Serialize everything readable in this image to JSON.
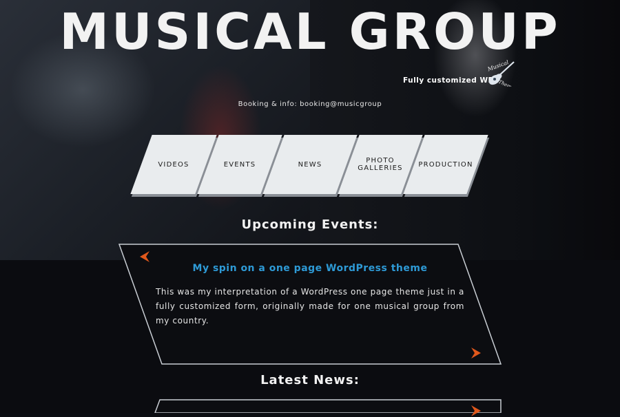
{
  "header": {
    "brand": "MUSICAL GROUP",
    "tagline": "Fully customized WP",
    "logo_text": "Musical Theme",
    "booking": "Booking & info: booking@musicgroup"
  },
  "nav": {
    "items": [
      {
        "label": "VIDEOS"
      },
      {
        "label": "EVENTS"
      },
      {
        "label": "NEWS"
      },
      {
        "label": "PHOTO GALLERIES"
      },
      {
        "label": "PRODUCTION"
      }
    ]
  },
  "events": {
    "heading": "Upcoming Events:",
    "card": {
      "title": "My spin on a one page WordPress theme",
      "body": "This was my interpretation of a WordPress one page theme just in a fully customized form, originally made for one musical group from my country."
    }
  },
  "news": {
    "heading": "Latest News:"
  },
  "colors": {
    "accent_blue": "#2e9ad6",
    "arrow_orange": "#e0581c",
    "nav_tile": "#e9ecee",
    "background": "#0b0d12"
  },
  "icons": {
    "prev": "chevron-left-icon",
    "next": "chevron-right-icon",
    "logo": "guitar-logo-icon"
  }
}
